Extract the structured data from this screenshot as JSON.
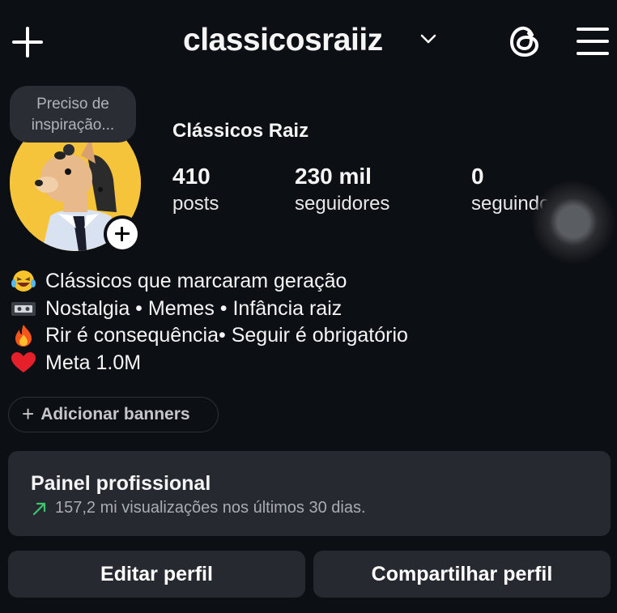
{
  "header": {
    "username": "classicosraiiz"
  },
  "note": {
    "text_line1": "Preciso de",
    "text_line2": "inspiração..."
  },
  "profile": {
    "display_name": "Clássicos Raiz",
    "stats": {
      "posts_count": "410",
      "posts_label": "posts",
      "followers_count": "230 mil",
      "followers_label": "seguidores",
      "following_count": "0",
      "following_label": "seguindo"
    }
  },
  "bio": {
    "lines": [
      {
        "icon": "laughing-emoji",
        "text": "Clássicos que marcaram geração"
      },
      {
        "icon": "vhs-tape-emoji",
        "text": "Nostalgia • Memes • Infância raiz"
      },
      {
        "icon": "fire-emoji",
        "text": "Rir é consequência• Seguir é obrigatório"
      },
      {
        "icon": "red-heart-emoji",
        "text": "Meta 1.0M"
      }
    ]
  },
  "banners": {
    "label": "Adicionar banners"
  },
  "dashboard": {
    "title": "Painel profissional",
    "subtitle": "157,2 mi visualizações nos últimos 30 dias.",
    "trend_color": "#3ec46d"
  },
  "actions": {
    "edit_label": "Editar perfil",
    "share_label": "Compartilhar perfil"
  },
  "colors": {
    "background": "#0c0f14",
    "card": "#26292f",
    "avatar_bg": "#f6c43a"
  }
}
